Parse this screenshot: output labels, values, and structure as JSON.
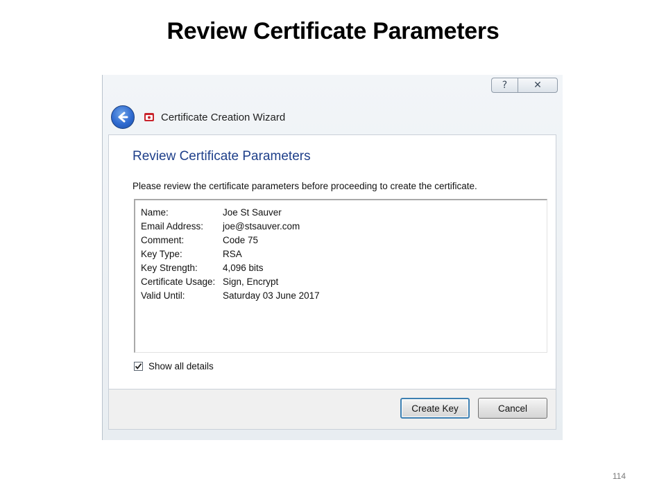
{
  "slide": {
    "title": "Review Certificate Parameters",
    "page_number": "114"
  },
  "window": {
    "title_buttons": {
      "help_label": "?",
      "close_label": "✕"
    },
    "wizard_title": "Certificate Creation Wizard",
    "icons": {
      "back": "back-arrow-icon",
      "app": "certificate-icon"
    },
    "colors": {
      "heading_blue": "#1e3f8a",
      "back_button_blue": "#2f6ad0",
      "primary_button_border": "#3c7fb1"
    }
  },
  "content": {
    "heading": "Review Certificate Parameters",
    "description": "Please review the certificate parameters before proceeding to create the certificate.",
    "parameters": [
      {
        "label": "Name:",
        "value": "Joe St Sauver"
      },
      {
        "label": "Email Address:",
        "value": "joe@stsauver.com"
      },
      {
        "label": "Comment:",
        "value": "Code 75"
      },
      {
        "label": "Key Type:",
        "value": "RSA"
      },
      {
        "label": "Key Strength:",
        "value": "4,096 bits"
      },
      {
        "label": "Certificate Usage:",
        "value": "Sign, Encrypt"
      },
      {
        "label": "Valid Until:",
        "value": "Saturday 03 June 2017"
      }
    ],
    "show_all_details": {
      "label": "Show all details",
      "checked": true
    }
  },
  "footer": {
    "create_key_label": "Create Key",
    "cancel_label": "Cancel"
  }
}
